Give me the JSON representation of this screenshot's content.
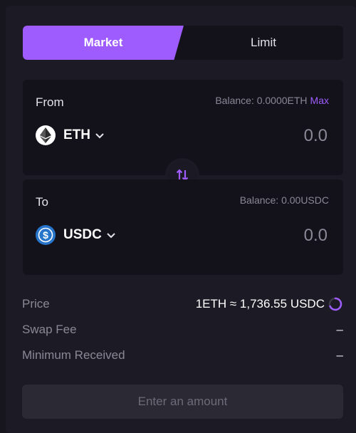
{
  "tabs": {
    "market": "Market",
    "limit": "Limit"
  },
  "from": {
    "label": "From",
    "balance_label": "Balance: 0.0000ETH",
    "max_label": "Max",
    "token": "ETH",
    "amount_placeholder": "0.0"
  },
  "to": {
    "label": "To",
    "balance_label": "Balance: 0.00USDC",
    "token": "USDC",
    "amount_placeholder": "0.0"
  },
  "info": {
    "price_label": "Price",
    "price_value": "1ETH ≈ 1,736.55 USDC",
    "fee_label": "Swap Fee",
    "fee_value": "–",
    "min_label": "Minimum Received",
    "min_value": "–"
  },
  "cta_label": "Enter an amount",
  "icons": {
    "from_token": "ethereum-icon",
    "to_token": "usdc-icon",
    "swap": "swap-arrows-icon",
    "refresh": "refresh-icon"
  },
  "colors": {
    "accent": "#9e5cff",
    "usdc": "#2775ca",
    "background": "#17161e",
    "panel": "#1c1b25",
    "box": "#13121a"
  }
}
